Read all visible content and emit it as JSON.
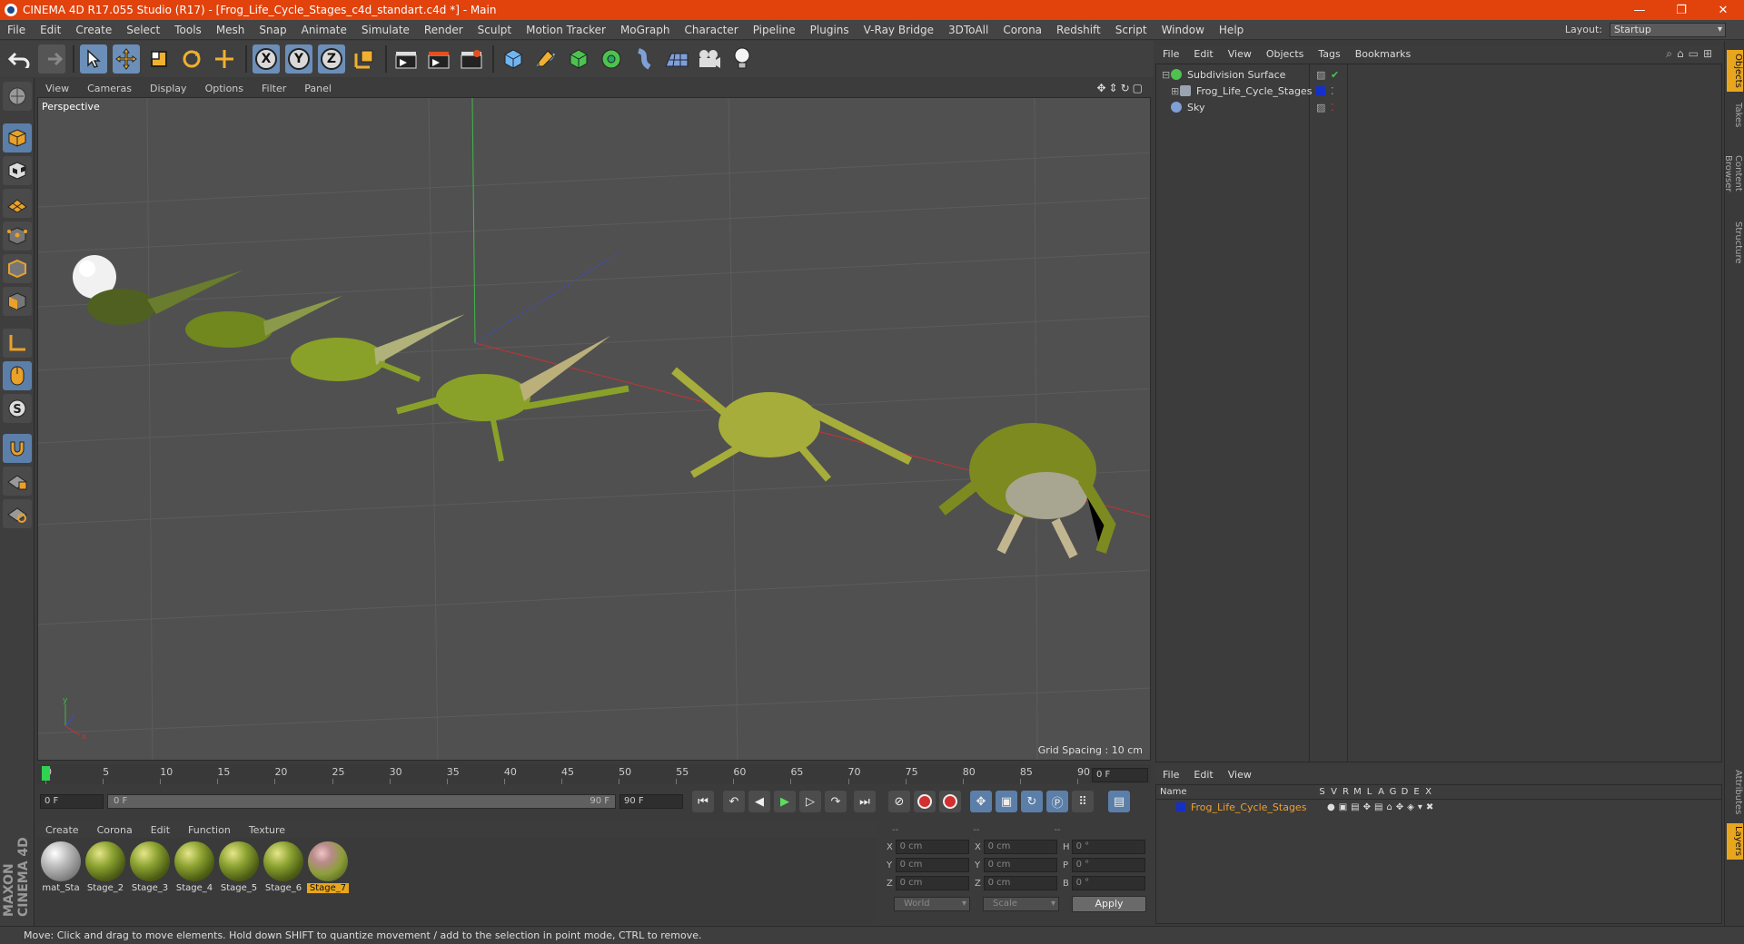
{
  "window": {
    "title": "CINEMA 4D R17.055 Studio (R17) - [Frog_Life_Cycle_Stages_c4d_standart.c4d *] - Main",
    "minimize": "—",
    "restore": "❐",
    "close": "✕"
  },
  "menu": [
    "File",
    "Edit",
    "Create",
    "Select",
    "Tools",
    "Mesh",
    "Snap",
    "Animate",
    "Simulate",
    "Render",
    "Sculpt",
    "Motion Tracker",
    "MoGraph",
    "Character",
    "Pipeline",
    "Plugins",
    "V-Ray Bridge",
    "3DToAll",
    "Corona",
    "Redshift",
    "Script",
    "Window",
    "Help"
  ],
  "layout": {
    "label": "Layout:",
    "value": "Startup"
  },
  "toolbar": {
    "x": "X",
    "y": "Y",
    "z": "Z"
  },
  "viewport": {
    "menu": [
      "View",
      "Cameras",
      "Display",
      "Options",
      "Filter",
      "Panel"
    ],
    "label": "Perspective",
    "grid_spacing": "Grid Spacing : 10 cm",
    "axis_y": "y",
    "axis_x": "x"
  },
  "timeline": {
    "ticks": [
      "0",
      "5",
      "10",
      "15",
      "20",
      "25",
      "30",
      "35",
      "40",
      "45",
      "50",
      "55",
      "60",
      "65",
      "70",
      "75",
      "80",
      "85",
      "90"
    ],
    "current_frame": "0 F"
  },
  "transport": {
    "start": "0 F",
    "range_start": "0 F",
    "range_end": "90 F",
    "end": "90 F"
  },
  "materials": {
    "menu": [
      "Create",
      "Corona",
      "Edit",
      "Function",
      "Texture"
    ],
    "items": [
      {
        "name": "mat_Sta",
        "style": "grey"
      },
      {
        "name": "Stage_2",
        "style": "green"
      },
      {
        "name": "Stage_3",
        "style": "green"
      },
      {
        "name": "Stage_4",
        "style": "green"
      },
      {
        "name": "Stage_5",
        "style": "green"
      },
      {
        "name": "Stage_6",
        "style": "green"
      },
      {
        "name": "Stage_7",
        "style": "pink",
        "selected": true
      }
    ]
  },
  "coords": {
    "headers": [
      "--",
      "--",
      "--"
    ],
    "rows": [
      {
        "a": "X",
        "av": "0 cm",
        "b": "X",
        "bv": "0 cm",
        "c": "H",
        "cv": "0 °"
      },
      {
        "a": "Y",
        "av": "0 cm",
        "b": "Y",
        "bv": "0 cm",
        "c": "P",
        "cv": "0 °"
      },
      {
        "a": "Z",
        "av": "0 cm",
        "b": "Z",
        "bv": "0 cm",
        "c": "B",
        "cv": "0 °"
      }
    ],
    "world": "World",
    "scale": "Scale",
    "apply": "Apply"
  },
  "status": "Move: Click and drag to move elements. Hold down SHIFT to quantize movement / add to the selection in point mode, CTRL to remove.",
  "objects": {
    "menu": [
      "File",
      "Edit",
      "View",
      "Objects",
      "Tags",
      "Bookmarks"
    ],
    "rows": [
      {
        "name": "Subdivision Surface",
        "icon": "#4ec24e"
      },
      {
        "name": "Frog_Life_Cycle_Stages",
        "icon": "#9aa4b0"
      },
      {
        "name": "Sky",
        "icon": "#7f9fd6"
      }
    ]
  },
  "layers": {
    "menu": [
      "File",
      "Edit",
      "View"
    ],
    "name_header": "Name",
    "cols": [
      "S",
      "V",
      "R",
      "M",
      "L",
      "A",
      "G",
      "D",
      "E",
      "X"
    ],
    "row": "Frog_Life_Cycle_Stages"
  },
  "sidetabs": [
    "Objects",
    "Takes",
    "Content Browser",
    "Structure",
    "Attributes",
    "Layers"
  ],
  "maxon": {
    "line1": "MAXON",
    "line2": "CINEMA 4D"
  }
}
